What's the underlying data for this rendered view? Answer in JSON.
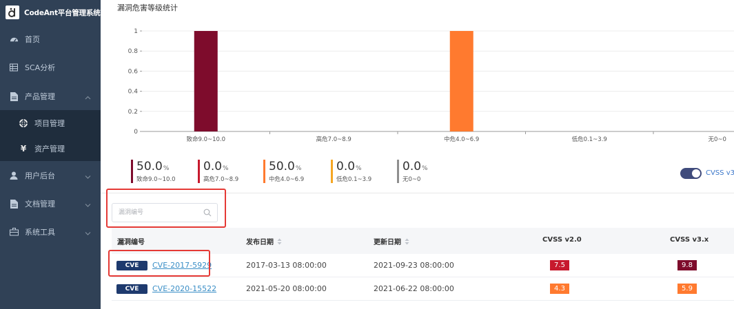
{
  "app": {
    "title": "CodeAnt平台管理系统"
  },
  "sidebar": {
    "items": [
      {
        "label": "首页",
        "icon": "dashboard-icon"
      },
      {
        "label": "SCA分析",
        "icon": "grid-icon"
      },
      {
        "label": "产品管理",
        "icon": "document-icon",
        "expanded": true
      },
      {
        "label": "项目管理",
        "icon": "lifebuoy-icon"
      },
      {
        "label": "资产管理",
        "icon": "yen-icon"
      },
      {
        "label": "用户后台",
        "icon": "user-icon"
      },
      {
        "label": "文档管理",
        "icon": "document-icon"
      },
      {
        "label": "系统工具",
        "icon": "toolbox-icon"
      }
    ]
  },
  "chart_section": {
    "title": "漏洞危害等级统计"
  },
  "chart_data": {
    "type": "bar",
    "categories": [
      "致命9.0~10.0",
      "高危7.0~8.9",
      "中危4.0~6.9",
      "低危0.1~3.9",
      "无0~0"
    ],
    "values": [
      1,
      0,
      1,
      0,
      0
    ],
    "colors": [
      "#7e0c2c",
      "#c7192d",
      "#ff7a2f",
      "#f5a623",
      "#8f8f8f"
    ],
    "yticks": [
      "0",
      "0.2",
      "0.4",
      "0.6",
      "0.8",
      "1"
    ],
    "ylim": [
      0,
      1
    ],
    "grid": true
  },
  "stats": [
    {
      "percent": "50.0",
      "unit": "%",
      "label": "致命9.0~10.0",
      "color": "#7e0c2c"
    },
    {
      "percent": "0.0",
      "unit": "%",
      "label": "高危7.0~8.9",
      "color": "#c7192d"
    },
    {
      "percent": "50.0",
      "unit": "%",
      "label": "中危4.0~6.9",
      "color": "#ff7a2f"
    },
    {
      "percent": "0.0",
      "unit": "%",
      "label": "低危0.1~3.9",
      "color": "#f5a623"
    },
    {
      "percent": "0.0",
      "unit": "%",
      "label": "无0~0",
      "color": "#8f8f8f"
    }
  ],
  "toggle": {
    "label": "CVSS v3",
    "on": true
  },
  "search": {
    "placeholder": "漏洞编号",
    "value": ""
  },
  "table": {
    "headers": [
      "漏洞编号",
      "发布日期",
      "更新日期",
      "CVSS v2.0",
      "CVSS v3.x"
    ],
    "rows": [
      {
        "tag": "CVE",
        "id": "CVE-2017-5929",
        "published": "2017-03-13 08:00:00",
        "updated": "2021-09-23 08:00:00",
        "cvss2": "7.5",
        "cvss2_color": "#c7192d",
        "cvss3": "9.8",
        "cvss3_color": "#7e0c2c"
      },
      {
        "tag": "CVE",
        "id": "CVE-2020-15522",
        "published": "2021-05-20 08:00:00",
        "updated": "2021-06-22 08:00:00",
        "cvss2": "4.3",
        "cvss2_color": "#ff7a2f",
        "cvss3": "5.9",
        "cvss3_color": "#ff7a2f"
      }
    ]
  }
}
